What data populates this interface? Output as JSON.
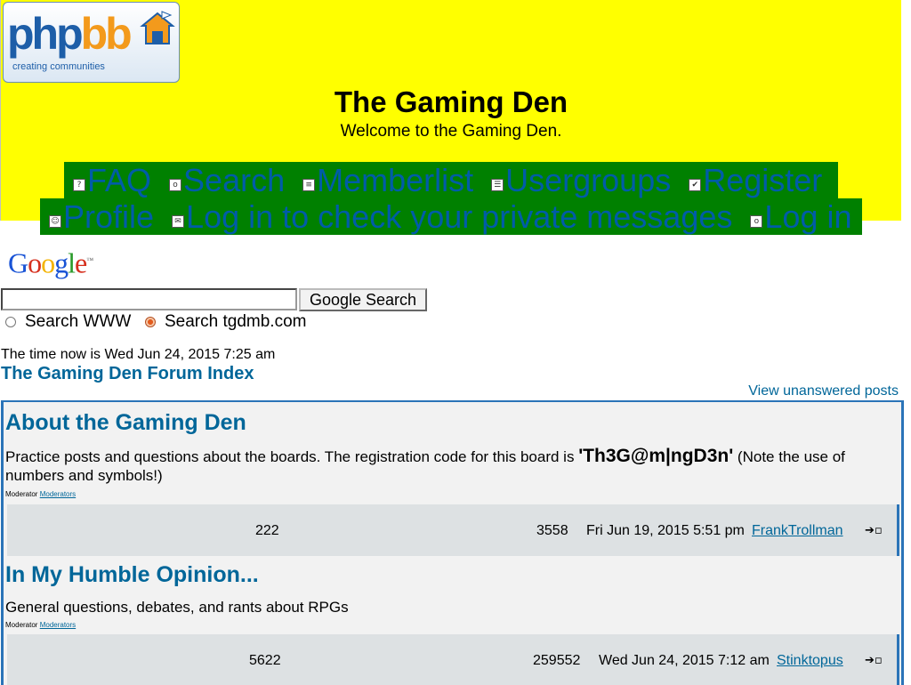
{
  "header": {
    "logo": {
      "word_php": "php",
      "word_bb": "bb",
      "tagline": "creating communities"
    },
    "title": "The Gaming Den",
    "description": "Welcome to the Gaming Den.",
    "nav_row_1": [
      {
        "label": "FAQ",
        "icon": "faq-icon",
        "glyph": "?"
      },
      {
        "label": "Search",
        "icon": "search-icon",
        "glyph": "o"
      },
      {
        "label": "Memberlist",
        "icon": "memberlist-icon",
        "glyph": "≡"
      },
      {
        "label": "Usergroups",
        "icon": "usergroups-icon",
        "glyph": "☰"
      },
      {
        "label": "Register",
        "icon": "register-icon",
        "glyph": "✔"
      }
    ],
    "nav_row_2": [
      {
        "label": "Profile",
        "icon": "profile-icon",
        "glyph": "☺"
      },
      {
        "label": "Log in to check your private messages",
        "icon": "messages-icon",
        "glyph": "✉"
      },
      {
        "label": "Log in",
        "icon": "login-icon",
        "glyph": "o"
      }
    ]
  },
  "google": {
    "logo_letters": [
      "G",
      "o",
      "o",
      "g",
      "l",
      "e"
    ],
    "logo_tm": "™",
    "search_value": "",
    "button_label": "Google Search",
    "radio_www": "Search WWW",
    "radio_site": "Search tgdmb.com",
    "selected": "site"
  },
  "time_now": "The time now is Wed Jun 24, 2015 7:25 am",
  "breadcrumb": "The Gaming Den Forum Index",
  "view_unanswered": "View unanswered posts",
  "forums": [
    {
      "title": "About the Gaming Den",
      "description_before": "Practice posts and questions about the boards. The registration code for this board is ",
      "registration_code": "'Th3G@m|ngD3n'",
      "description_after": " (Note the use of numbers and symbols!)",
      "moderator_label": "Moderator",
      "moderator_link": "Moderators",
      "topics": "222",
      "posts": "3558",
      "last_post_time": "Fri Jun 19, 2015 5:51 pm",
      "last_post_user": "FrankTrollman"
    },
    {
      "title": "In My Humble Opinion...",
      "description_before": "General questions, debates, and rants about RPGs",
      "moderator_label": "Moderator",
      "moderator_link": "Moderators",
      "topics": "5622",
      "posts": "259552",
      "last_post_time": "Wed Jun 24, 2015 7:12 am",
      "last_post_user": "Stinktopus"
    }
  ],
  "goto_glyph": "➔▫",
  "colors": {
    "header_bg": "#ffff00",
    "nav_bg": "#008000",
    "link": "#006699",
    "row_bg": "#dde1e3",
    "border": "#2b74b8"
  }
}
